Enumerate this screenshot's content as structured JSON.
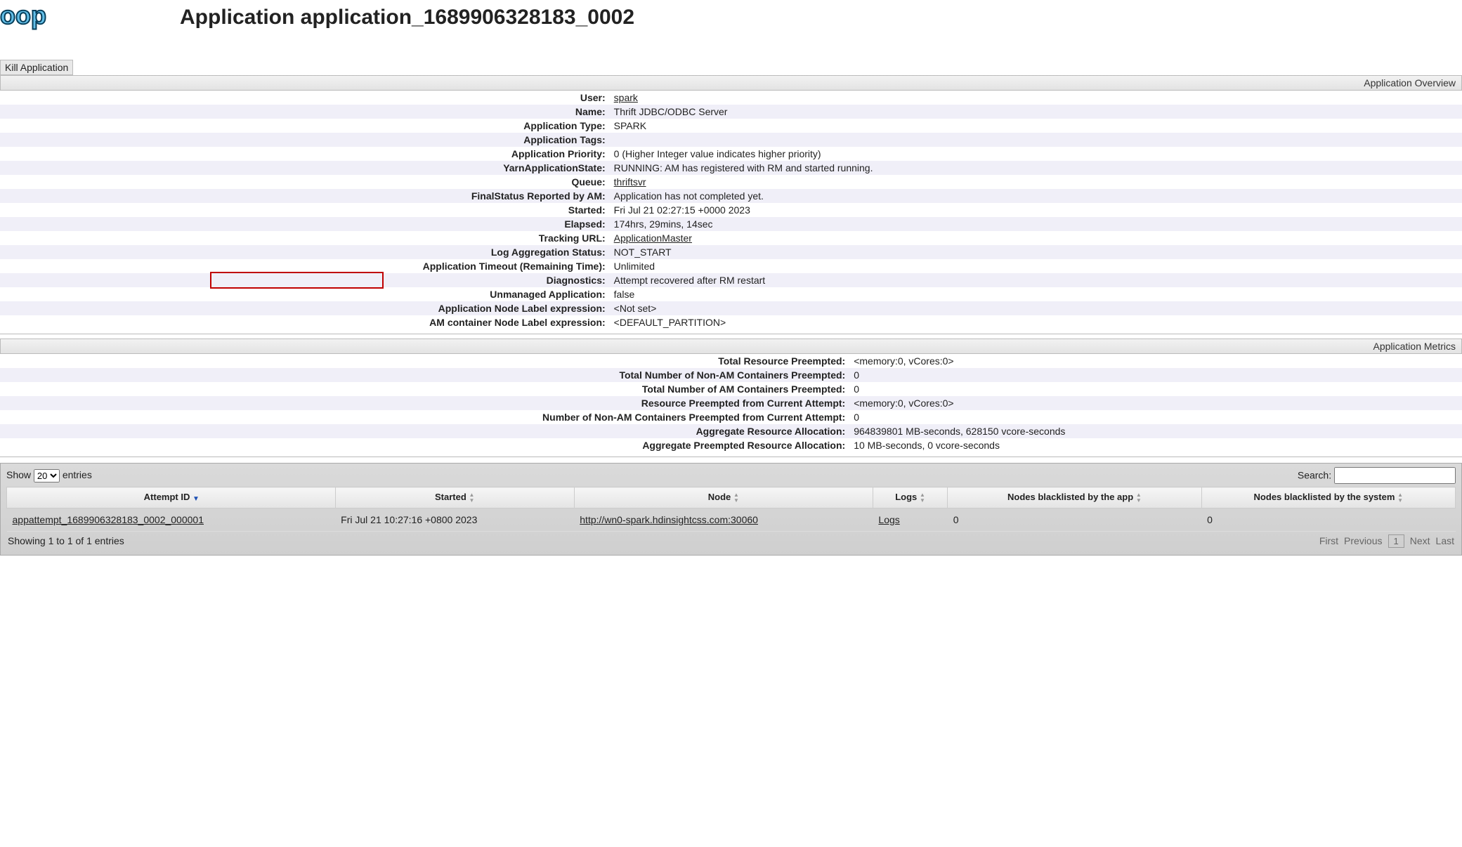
{
  "pageTitle": "Application application_1689906328183_0002",
  "killLabel": "Kill Application",
  "overview": {
    "header": "Application Overview",
    "rows": [
      {
        "k": "User:",
        "v": "spark",
        "link": true
      },
      {
        "k": "Name:",
        "v": "Thrift JDBC/ODBC Server"
      },
      {
        "k": "Application Type:",
        "v": "SPARK"
      },
      {
        "k": "Application Tags:",
        "v": ""
      },
      {
        "k": "Application Priority:",
        "v": "0 (Higher Integer value indicates higher priority)"
      },
      {
        "k": "YarnApplicationState:",
        "v": "RUNNING: AM has registered with RM and started running."
      },
      {
        "k": "Queue:",
        "v": "thriftsvr",
        "link": true
      },
      {
        "k": "FinalStatus Reported by AM:",
        "v": "Application has not completed yet."
      },
      {
        "k": "Started:",
        "v": "Fri Jul 21 02:27:15 +0000 2023"
      },
      {
        "k": "Elapsed:",
        "v": "174hrs, 29mins, 14sec"
      },
      {
        "k": "Tracking URL:",
        "v": "ApplicationMaster",
        "link": true
      },
      {
        "k": "Log Aggregation Status:",
        "v": "NOT_START"
      },
      {
        "k": "Application Timeout (Remaining Time):",
        "v": "Unlimited"
      },
      {
        "k": "Diagnostics:",
        "v": "Attempt recovered after RM restart",
        "hl": true
      },
      {
        "k": "Unmanaged Application:",
        "v": "false"
      },
      {
        "k": "Application Node Label expression:",
        "v": "<Not set>"
      },
      {
        "k": "AM container Node Label expression:",
        "v": "<DEFAULT_PARTITION>"
      }
    ]
  },
  "metrics": {
    "header": "Application Metrics",
    "rows": [
      {
        "k": "Total Resource Preempted:",
        "v": "<memory:0, vCores:0>"
      },
      {
        "k": "Total Number of Non-AM Containers Preempted:",
        "v": "0"
      },
      {
        "k": "Total Number of AM Containers Preempted:",
        "v": "0"
      },
      {
        "k": "Resource Preempted from Current Attempt:",
        "v": "<memory:0, vCores:0>"
      },
      {
        "k": "Number of Non-AM Containers Preempted from Current Attempt:",
        "v": "0"
      },
      {
        "k": "Aggregate Resource Allocation:",
        "v": "964839801 MB-seconds, 628150 vcore-seconds"
      },
      {
        "k": "Aggregate Preempted Resource Allocation:",
        "v": "10 MB-seconds, 0 vcore-seconds"
      }
    ]
  },
  "attempts": {
    "showLabel": "Show",
    "entriesLabel": "entries",
    "lengthOptions": [
      "20"
    ],
    "lengthSelected": "20",
    "searchLabel": "Search:",
    "columns": [
      "Attempt ID",
      "Started",
      "Node",
      "Logs",
      "Nodes blacklisted by the app",
      "Nodes blacklisted by the system"
    ],
    "rows": [
      {
        "attemptId": "appattempt_1689906328183_0002_000001",
        "started": "Fri Jul 21 10:27:16 +0800 2023",
        "node": "http://wn0-spark.hdinsightcss.com:30060",
        "logs": "Logs",
        "blkApp": "0",
        "blkSys": "0"
      }
    ],
    "info": "Showing 1 to 1 of 1 entries",
    "pager": {
      "first": "First",
      "previous": "Previous",
      "page": "1",
      "next": "Next",
      "last": "Last"
    }
  }
}
